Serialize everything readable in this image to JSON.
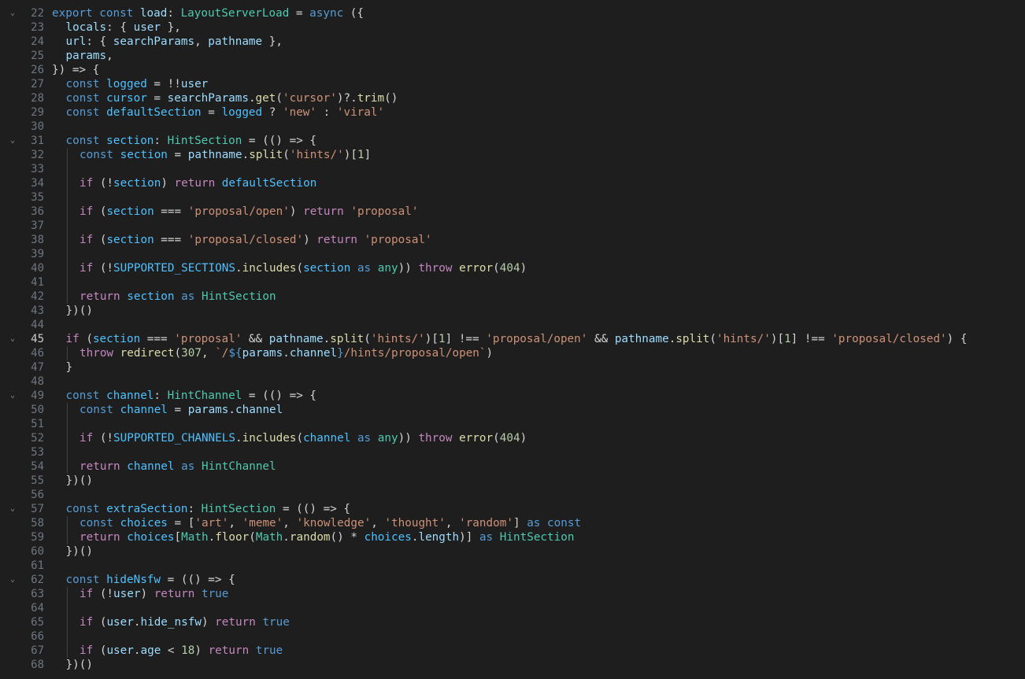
{
  "editor": {
    "language": "typescript",
    "active_line": 45,
    "fold_icon": "chevron-down-icon",
    "fold_lines": [
      22,
      31,
      45,
      49,
      57,
      62
    ],
    "colors": {
      "background": "#1e1e1e",
      "keyword": "#569cd6",
      "control": "#c586c0",
      "type": "#4ec9b0",
      "variable": "#9cdcfe",
      "function": "#dcdcaa",
      "string": "#ce9178",
      "number": "#b5cea8",
      "constant": "#4fc1ff",
      "line_number": "#6e7681",
      "active_line_number": "#cccccc"
    },
    "lines": [
      {
        "n": "22",
        "indent": 0,
        "tokens": [
          [
            "k",
            "export "
          ],
          [
            "k",
            "const "
          ],
          [
            "v",
            "load"
          ],
          [
            "p",
            ": "
          ],
          [
            "t",
            "LayoutServerLoad"
          ],
          [
            "p",
            " = "
          ],
          [
            "k",
            "async "
          ],
          [
            "p",
            "({"
          ]
        ]
      },
      {
        "n": "23",
        "indent": 1,
        "tokens": [
          [
            "v",
            "locals"
          ],
          [
            "p",
            ": { "
          ],
          [
            "v",
            "user"
          ],
          [
            "p",
            " },"
          ]
        ]
      },
      {
        "n": "24",
        "indent": 1,
        "tokens": [
          [
            "v",
            "url"
          ],
          [
            "p",
            ": { "
          ],
          [
            "v",
            "searchParams"
          ],
          [
            "p",
            ", "
          ],
          [
            "v",
            "pathname"
          ],
          [
            "p",
            " },"
          ]
        ]
      },
      {
        "n": "25",
        "indent": 1,
        "tokens": [
          [
            "v",
            "params"
          ],
          [
            "p",
            ","
          ]
        ]
      },
      {
        "n": "26",
        "indent": 0,
        "tokens": [
          [
            "p",
            "}) => {"
          ]
        ]
      },
      {
        "n": "27",
        "indent": 1,
        "tokens": [
          [
            "k",
            "const "
          ],
          [
            "cn",
            "logged"
          ],
          [
            "p",
            " = !!"
          ],
          [
            "v",
            "user"
          ]
        ]
      },
      {
        "n": "28",
        "indent": 1,
        "tokens": [
          [
            "k",
            "const "
          ],
          [
            "cn",
            "cursor"
          ],
          [
            "p",
            " = "
          ],
          [
            "v",
            "searchParams"
          ],
          [
            "p",
            "."
          ],
          [
            "f",
            "get"
          ],
          [
            "p",
            "("
          ],
          [
            "s",
            "'cursor'"
          ],
          [
            "p",
            ")?."
          ],
          [
            "f",
            "trim"
          ],
          [
            "p",
            "()"
          ]
        ]
      },
      {
        "n": "29",
        "indent": 1,
        "tokens": [
          [
            "k",
            "const "
          ],
          [
            "cn",
            "defaultSection"
          ],
          [
            "p",
            " = "
          ],
          [
            "cn",
            "logged"
          ],
          [
            "p",
            " ? "
          ],
          [
            "s",
            "'new'"
          ],
          [
            "p",
            " : "
          ],
          [
            "s",
            "'viral'"
          ]
        ]
      },
      {
        "n": "30",
        "indent": 1,
        "tokens": []
      },
      {
        "n": "31",
        "indent": 1,
        "tokens": [
          [
            "k",
            "const "
          ],
          [
            "cn",
            "section"
          ],
          [
            "p",
            ": "
          ],
          [
            "t",
            "HintSection"
          ],
          [
            "p",
            " = (() => {"
          ]
        ]
      },
      {
        "n": "32",
        "indent": 2,
        "tokens": [
          [
            "k",
            "const "
          ],
          [
            "cn",
            "section"
          ],
          [
            "p",
            " = "
          ],
          [
            "v",
            "pathname"
          ],
          [
            "p",
            "."
          ],
          [
            "f",
            "split"
          ],
          [
            "p",
            "("
          ],
          [
            "s",
            "'hints/'"
          ],
          [
            "p",
            ")["
          ],
          [
            "n",
            "1"
          ],
          [
            "p",
            "]"
          ]
        ]
      },
      {
        "n": "33",
        "indent": 2,
        "tokens": []
      },
      {
        "n": "34",
        "indent": 2,
        "tokens": [
          [
            "c",
            "if "
          ],
          [
            "p",
            "(!"
          ],
          [
            "cn",
            "section"
          ],
          [
            "p",
            ") "
          ],
          [
            "c",
            "return "
          ],
          [
            "cn",
            "defaultSection"
          ]
        ]
      },
      {
        "n": "35",
        "indent": 2,
        "tokens": []
      },
      {
        "n": "36",
        "indent": 2,
        "tokens": [
          [
            "c",
            "if "
          ],
          [
            "p",
            "("
          ],
          [
            "cn",
            "section"
          ],
          [
            "p",
            " === "
          ],
          [
            "s",
            "'proposal/open'"
          ],
          [
            "p",
            ") "
          ],
          [
            "c",
            "return "
          ],
          [
            "s",
            "'proposal'"
          ]
        ]
      },
      {
        "n": "37",
        "indent": 2,
        "tokens": []
      },
      {
        "n": "38",
        "indent": 2,
        "tokens": [
          [
            "c",
            "if "
          ],
          [
            "p",
            "("
          ],
          [
            "cn",
            "section"
          ],
          [
            "p",
            " === "
          ],
          [
            "s",
            "'proposal/closed'"
          ],
          [
            "p",
            ") "
          ],
          [
            "c",
            "return "
          ],
          [
            "s",
            "'proposal'"
          ]
        ]
      },
      {
        "n": "39",
        "indent": 2,
        "tokens": []
      },
      {
        "n": "40",
        "indent": 2,
        "tokens": [
          [
            "c",
            "if "
          ],
          [
            "p",
            "(!"
          ],
          [
            "cn",
            "SUPPORTED_SECTIONS"
          ],
          [
            "p",
            "."
          ],
          [
            "f",
            "includes"
          ],
          [
            "p",
            "("
          ],
          [
            "cn",
            "section"
          ],
          [
            "k",
            " as "
          ],
          [
            "t",
            "any"
          ],
          [
            "p",
            ")) "
          ],
          [
            "c",
            "throw "
          ],
          [
            "f",
            "error"
          ],
          [
            "p",
            "("
          ],
          [
            "n",
            "404"
          ],
          [
            "p",
            ")"
          ]
        ]
      },
      {
        "n": "41",
        "indent": 2,
        "tokens": []
      },
      {
        "n": "42",
        "indent": 2,
        "tokens": [
          [
            "c",
            "return "
          ],
          [
            "cn",
            "section"
          ],
          [
            "k",
            " as "
          ],
          [
            "t",
            "HintSection"
          ]
        ]
      },
      {
        "n": "43",
        "indent": 1,
        "tokens": [
          [
            "p",
            "})()"
          ]
        ]
      },
      {
        "n": "44",
        "indent": 1,
        "tokens": []
      },
      {
        "n": "45",
        "indent": 1,
        "tokens": [
          [
            "c",
            "if "
          ],
          [
            "p",
            "("
          ],
          [
            "cn",
            "section"
          ],
          [
            "p",
            " === "
          ],
          [
            "s",
            "'proposal'"
          ],
          [
            "p",
            " && "
          ],
          [
            "v",
            "pathname"
          ],
          [
            "p",
            "."
          ],
          [
            "f",
            "split"
          ],
          [
            "p",
            "("
          ],
          [
            "s",
            "'hints/'"
          ],
          [
            "p",
            ")["
          ],
          [
            "n",
            "1"
          ],
          [
            "p",
            "] !== "
          ],
          [
            "s",
            "'proposal/open'"
          ],
          [
            "p",
            " && "
          ],
          [
            "v",
            "pathname"
          ],
          [
            "p",
            "."
          ],
          [
            "f",
            "split"
          ],
          [
            "p",
            "("
          ],
          [
            "s",
            "'hints/'"
          ],
          [
            "p",
            ")["
          ],
          [
            "n",
            "1"
          ],
          [
            "p",
            "] !== "
          ],
          [
            "s",
            "'proposal/closed'"
          ],
          [
            "p",
            ") {"
          ]
        ]
      },
      {
        "n": "46",
        "indent": 2,
        "tokens": [
          [
            "c",
            "throw "
          ],
          [
            "f",
            "redirect"
          ],
          [
            "p",
            "("
          ],
          [
            "n",
            "307"
          ],
          [
            "p",
            ", "
          ],
          [
            "s",
            "`/"
          ],
          [
            "k",
            "${"
          ],
          [
            "v",
            "params"
          ],
          [
            "p",
            "."
          ],
          [
            "v",
            "channel"
          ],
          [
            "k",
            "}"
          ],
          [
            "s",
            "/hints/proposal/open`"
          ],
          [
            "p",
            ")"
          ]
        ]
      },
      {
        "n": "47",
        "indent": 1,
        "tokens": [
          [
            "p",
            "}"
          ]
        ]
      },
      {
        "n": "48",
        "indent": 1,
        "tokens": []
      },
      {
        "n": "49",
        "indent": 1,
        "tokens": [
          [
            "k",
            "const "
          ],
          [
            "cn",
            "channel"
          ],
          [
            "p",
            ": "
          ],
          [
            "t",
            "HintChannel"
          ],
          [
            "p",
            " = (() => {"
          ]
        ]
      },
      {
        "n": "50",
        "indent": 2,
        "tokens": [
          [
            "k",
            "const "
          ],
          [
            "cn",
            "channel"
          ],
          [
            "p",
            " = "
          ],
          [
            "v",
            "params"
          ],
          [
            "p",
            "."
          ],
          [
            "v",
            "channel"
          ]
        ]
      },
      {
        "n": "51",
        "indent": 2,
        "tokens": []
      },
      {
        "n": "52",
        "indent": 2,
        "tokens": [
          [
            "c",
            "if "
          ],
          [
            "p",
            "(!"
          ],
          [
            "cn",
            "SUPPORTED_CHANNELS"
          ],
          [
            "p",
            "."
          ],
          [
            "f",
            "includes"
          ],
          [
            "p",
            "("
          ],
          [
            "cn",
            "channel"
          ],
          [
            "k",
            " as "
          ],
          [
            "t",
            "any"
          ],
          [
            "p",
            ")) "
          ],
          [
            "c",
            "throw "
          ],
          [
            "f",
            "error"
          ],
          [
            "p",
            "("
          ],
          [
            "n",
            "404"
          ],
          [
            "p",
            ")"
          ]
        ]
      },
      {
        "n": "53",
        "indent": 2,
        "tokens": []
      },
      {
        "n": "54",
        "indent": 2,
        "tokens": [
          [
            "c",
            "return "
          ],
          [
            "cn",
            "channel"
          ],
          [
            "k",
            " as "
          ],
          [
            "t",
            "HintChannel"
          ]
        ]
      },
      {
        "n": "55",
        "indent": 1,
        "tokens": [
          [
            "p",
            "})()"
          ]
        ]
      },
      {
        "n": "56",
        "indent": 1,
        "tokens": []
      },
      {
        "n": "57",
        "indent": 1,
        "tokens": [
          [
            "k",
            "const "
          ],
          [
            "cn",
            "extraSection"
          ],
          [
            "p",
            ": "
          ],
          [
            "t",
            "HintSection"
          ],
          [
            "p",
            " = (() => {"
          ]
        ]
      },
      {
        "n": "58",
        "indent": 2,
        "tokens": [
          [
            "k",
            "const "
          ],
          [
            "cn",
            "choices"
          ],
          [
            "p",
            " = ["
          ],
          [
            "s",
            "'art'"
          ],
          [
            "p",
            ", "
          ],
          [
            "s",
            "'meme'"
          ],
          [
            "p",
            ", "
          ],
          [
            "s",
            "'knowledge'"
          ],
          [
            "p",
            ", "
          ],
          [
            "s",
            "'thought'"
          ],
          [
            "p",
            ", "
          ],
          [
            "s",
            "'random'"
          ],
          [
            "p",
            "] "
          ],
          [
            "k",
            "as const"
          ]
        ]
      },
      {
        "n": "59",
        "indent": 2,
        "tokens": [
          [
            "c",
            "return "
          ],
          [
            "cn",
            "choices"
          ],
          [
            "p",
            "["
          ],
          [
            "t",
            "Math"
          ],
          [
            "p",
            "."
          ],
          [
            "f",
            "floor"
          ],
          [
            "p",
            "("
          ],
          [
            "t",
            "Math"
          ],
          [
            "p",
            "."
          ],
          [
            "f",
            "random"
          ],
          [
            "p",
            "() * "
          ],
          [
            "cn",
            "choices"
          ],
          [
            "p",
            "."
          ],
          [
            "v",
            "length"
          ],
          [
            "p",
            ")] "
          ],
          [
            "k",
            "as "
          ],
          [
            "t",
            "HintSection"
          ]
        ]
      },
      {
        "n": "60",
        "indent": 1,
        "tokens": [
          [
            "p",
            "})()"
          ]
        ]
      },
      {
        "n": "61",
        "indent": 1,
        "tokens": []
      },
      {
        "n": "62",
        "indent": 1,
        "tokens": [
          [
            "k",
            "const "
          ],
          [
            "cn",
            "hideNsfw"
          ],
          [
            "p",
            " = (() => {"
          ]
        ]
      },
      {
        "n": "63",
        "indent": 2,
        "tokens": [
          [
            "c",
            "if "
          ],
          [
            "p",
            "(!"
          ],
          [
            "v",
            "user"
          ],
          [
            "p",
            ") "
          ],
          [
            "c",
            "return "
          ],
          [
            "k",
            "true"
          ]
        ]
      },
      {
        "n": "64",
        "indent": 2,
        "tokens": []
      },
      {
        "n": "65",
        "indent": 2,
        "tokens": [
          [
            "c",
            "if "
          ],
          [
            "p",
            "("
          ],
          [
            "v",
            "user"
          ],
          [
            "p",
            "."
          ],
          [
            "v",
            "hide_nsfw"
          ],
          [
            "p",
            ") "
          ],
          [
            "c",
            "return "
          ],
          [
            "k",
            "true"
          ]
        ]
      },
      {
        "n": "66",
        "indent": 2,
        "tokens": []
      },
      {
        "n": "67",
        "indent": 2,
        "tokens": [
          [
            "c",
            "if "
          ],
          [
            "p",
            "("
          ],
          [
            "v",
            "user"
          ],
          [
            "p",
            "."
          ],
          [
            "v",
            "age"
          ],
          [
            "p",
            " < "
          ],
          [
            "n",
            "18"
          ],
          [
            "p",
            ") "
          ],
          [
            "c",
            "return "
          ],
          [
            "k",
            "true"
          ]
        ]
      },
      {
        "n": "68",
        "indent": 1,
        "tokens": [
          [
            "p",
            "})()"
          ]
        ]
      }
    ]
  }
}
